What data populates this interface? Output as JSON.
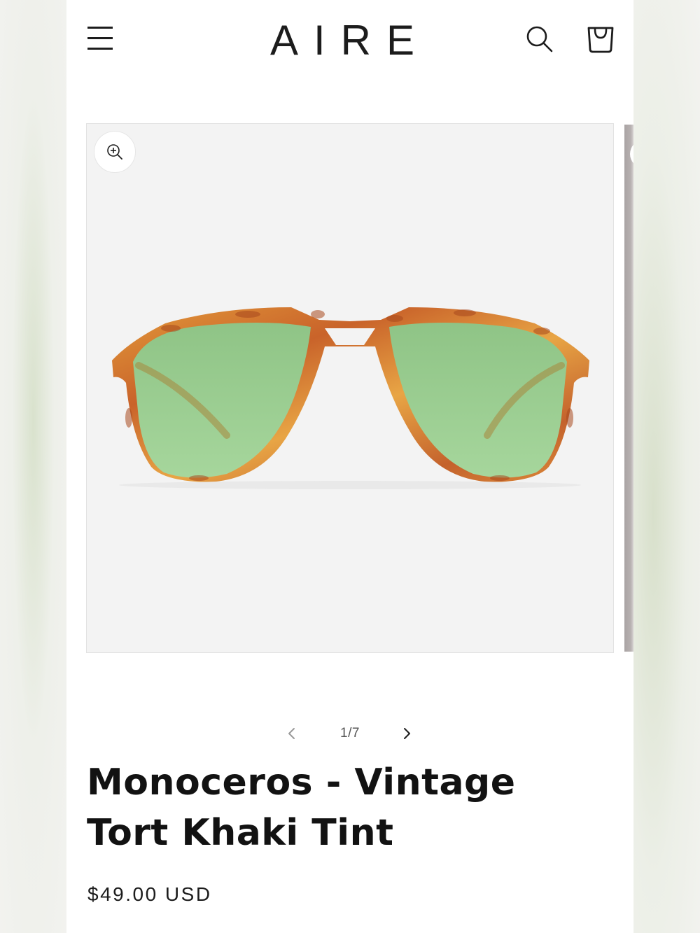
{
  "header": {
    "brand": "AIRE",
    "menu_icon": "hamburger-menu-icon",
    "search_icon": "search-icon",
    "cart_icon": "shopping-bag-icon"
  },
  "gallery": {
    "zoom_icon": "zoom-in-icon",
    "image_subject": "sunglasses-product-photo",
    "pager": {
      "current": "1/7",
      "prev_icon": "chevron-left-icon",
      "next_icon": "chevron-right-icon"
    }
  },
  "product": {
    "title": "Monoceros - Vintage Tort Khaki Tint",
    "price": "$49.00 USD"
  },
  "colors": {
    "text": "#121212",
    "image_bg": "#f3f3f3",
    "lens": "#9ccf94",
    "frame": "#d9822e"
  }
}
